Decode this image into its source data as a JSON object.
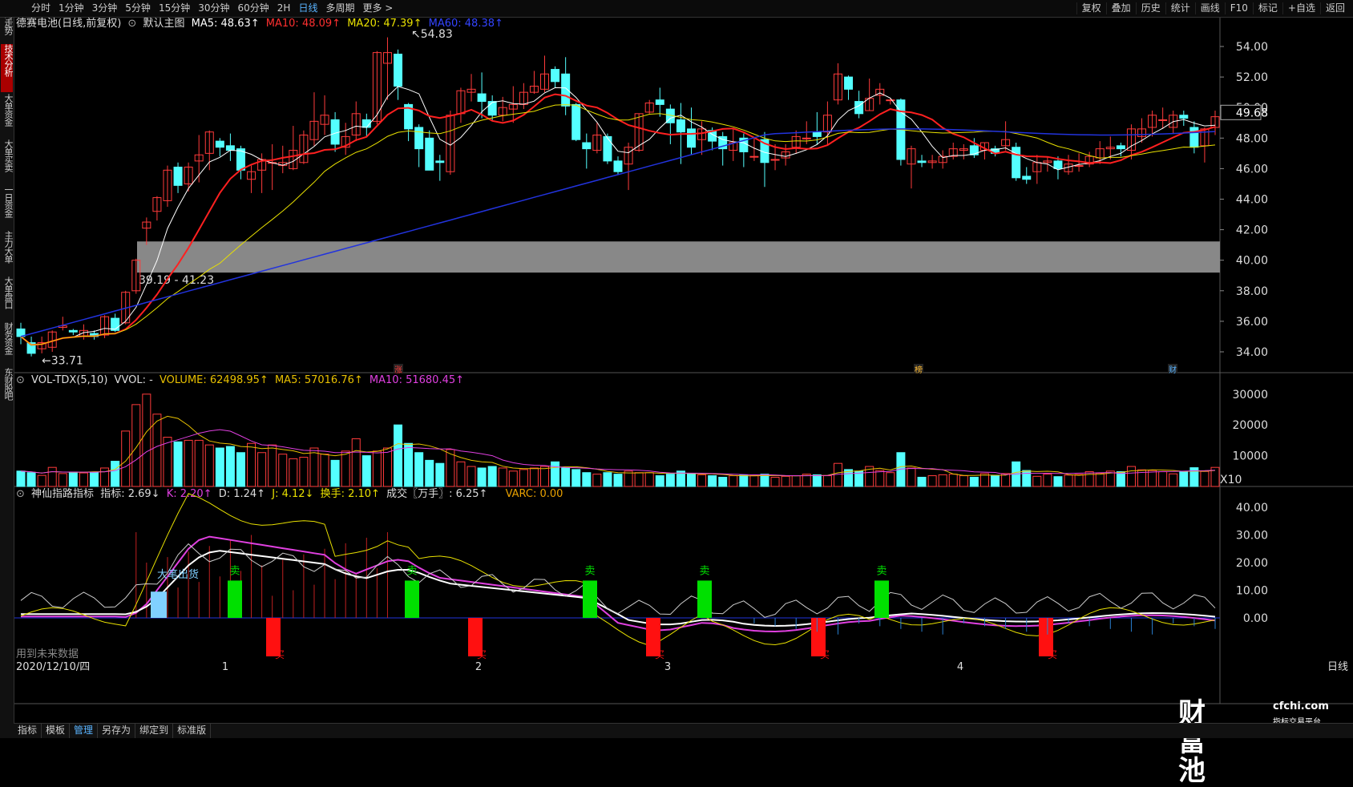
{
  "toolbar": {
    "periods": [
      "分时",
      "1分钟",
      "3分钟",
      "5分钟",
      "15分钟",
      "30分钟",
      "60分钟",
      "2H",
      "日线",
      "多周期",
      "更多 >"
    ],
    "active_period": "日线",
    "right_buttons": [
      "复权",
      "叠加",
      "历史",
      "统计",
      "画线",
      "F10",
      "标记",
      "+自选",
      "返回"
    ]
  },
  "sidebar_tabs": [
    "分时走势",
    "技术分析",
    "大单资金",
    "大单买卖",
    "一日资金",
    "主力大单",
    "大单盘口",
    "财务资金",
    "东财股吧"
  ],
  "main_chart": {
    "title": "德赛电池(日线,前复权)",
    "template": "默认主图",
    "ma5": "MA5: 48.63↑",
    "ma10": "MA10: 48.09↑",
    "ma20": "MA20: 47.39↑",
    "ma60": "MA60: 48.38↑",
    "price_ticks": [
      "54.00",
      "52.00",
      "50.00",
      "48.00",
      "46.00",
      "44.00",
      "42.00",
      "40.00",
      "38.00",
      "36.00",
      "34.00"
    ],
    "current_price": "49.68",
    "high_label": "54.83",
    "low_label": "33.71",
    "zone_label": "39.19 - 41.23",
    "markers": [
      "涨",
      "榜",
      "财"
    ],
    "colors": {
      "up": "#ff3b3b",
      "down": "#54ffff",
      "ma5": "#ffffff",
      "ma10": "#ff2020",
      "ma20": "#e8e000",
      "ma60": "#2233dd",
      "zone": "#888888"
    }
  },
  "volume_chart": {
    "name": "VOL-TDX(5,10)",
    "vvol": "VVOL: -",
    "volume": "VOLUME: 62498.95↑",
    "ma5": "MA5: 57016.76↑",
    "ma10": "MA10: 51680.45↑",
    "ticks": [
      "30000",
      "20000",
      "10000"
    ],
    "unit": "X10"
  },
  "indicator_chart": {
    "name": "神仙指路指标",
    "zhibiao": "指标: 2.69↓",
    "k": "K: 2.20↑",
    "d": "D: 1.24↑",
    "j": "J: 4.12↓",
    "huanshou": "换手: 2.10↑",
    "chengjiao": "成交〖万手〗: 6.25↑",
    "varc": "VARC: 0.00",
    "ticks": [
      "40.00",
      "30.00",
      "20.00",
      "10.00",
      "0.00"
    ],
    "sell_label": "卖",
    "buy_label": "买",
    "big_label": "大笔出货",
    "future_text": "用到未来数据"
  },
  "date_axis": {
    "date_label": "2020/12/10/四",
    "months": [
      "1",
      "2",
      "3",
      "4"
    ],
    "period_label": "日线"
  },
  "bottom_tabs": [
    "指标",
    "模板",
    "管理",
    "另存为",
    "绑定到",
    "标准版"
  ],
  "active_bottom_tab": "管理",
  "watermark": {
    "brand": "财富池",
    "site": "cfchi.com",
    "slogan": "指标交易平台"
  }
}
